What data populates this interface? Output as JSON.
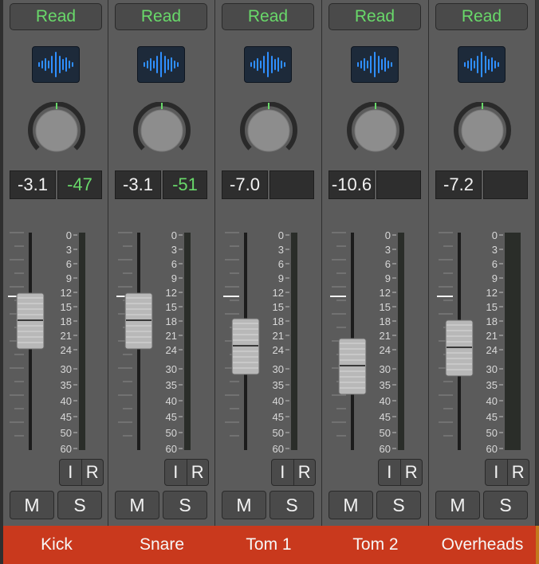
{
  "colors": {
    "accent_green": "#69d96a",
    "name_bar": "#c9391d",
    "strip_bg": "#5b5b5b",
    "plugin_wave": "#2f8fff"
  },
  "meter_scale": [
    "0",
    "3",
    "6",
    "9",
    "12",
    "15",
    "18",
    "21",
    "24",
    "30",
    "35",
    "40",
    "45",
    "50",
    "60"
  ],
  "channels": [
    {
      "name": "Kick",
      "automation": "Read",
      "volume": "-3.1",
      "peak": "-47",
      "input_label": "I",
      "record_label": "R",
      "mute_label": "M",
      "solo_label": "S",
      "fader_db": -3.1,
      "icon": "waveform-icon"
    },
    {
      "name": "Snare",
      "automation": "Read",
      "volume": "-3.1",
      "peak": "-51",
      "input_label": "I",
      "record_label": "R",
      "mute_label": "M",
      "solo_label": "S",
      "fader_db": -3.1,
      "icon": "waveform-icon"
    },
    {
      "name": "Tom 1",
      "automation": "Read",
      "volume": "-7.0",
      "peak": "",
      "input_label": "I",
      "record_label": "R",
      "mute_label": "M",
      "solo_label": "S",
      "fader_db": -7.0,
      "icon": "waveform-icon"
    },
    {
      "name": "Tom 2",
      "automation": "Read",
      "volume": "-10.6",
      "peak": "",
      "input_label": "I",
      "record_label": "R",
      "mute_label": "M",
      "solo_label": "S",
      "fader_db": -10.6,
      "icon": "waveform-icon"
    },
    {
      "name": "Overheads",
      "automation": "Read",
      "volume": "-7.2",
      "peak": "",
      "input_label": "I",
      "record_label": "R",
      "mute_label": "M",
      "solo_label": "S",
      "fader_db": -7.2,
      "icon": "waveform-icon"
    }
  ]
}
